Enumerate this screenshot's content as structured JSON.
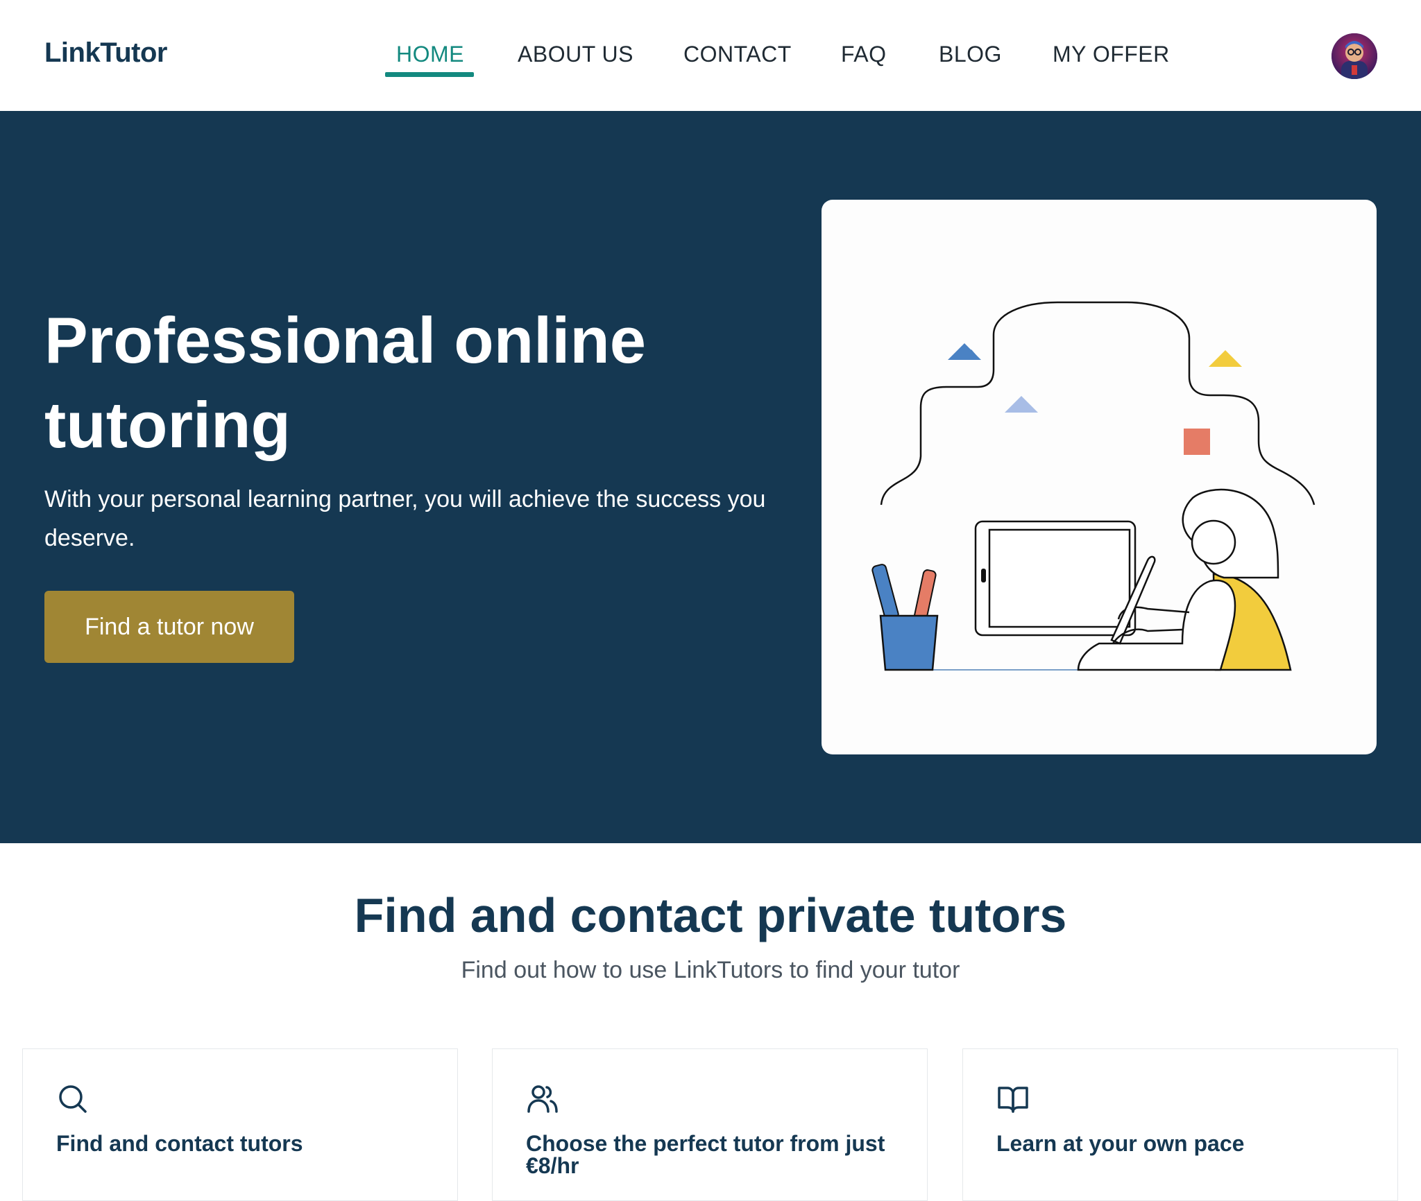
{
  "header": {
    "logo": "LinkTutor",
    "nav": [
      {
        "label": "HOME",
        "active": true
      },
      {
        "label": "ABOUT US",
        "active": false
      },
      {
        "label": "CONTACT",
        "active": false
      },
      {
        "label": "FAQ",
        "active": false
      },
      {
        "label": "BLOG",
        "active": false
      },
      {
        "label": "MY OFFER",
        "active": false
      }
    ],
    "avatar_icon": "user-avatar"
  },
  "hero": {
    "title": "Professional online tutoring",
    "subtitle": "With your personal learning partner, you will achieve the success you deserve.",
    "cta_label": "Find a tutor now",
    "illustration": "person-studying-at-tablet-illustration"
  },
  "section": {
    "title": "Find and contact private tutors",
    "subtitle": "Find out how to use LinkTutors to find your tutor"
  },
  "features": [
    {
      "icon": "search-icon",
      "title": "Find and contact tutors"
    },
    {
      "icon": "users-icon",
      "title": "Choose the perfect tutor from just €8/hr"
    },
    {
      "icon": "book-open-icon",
      "title": "Learn at your own pace"
    }
  ],
  "colors": {
    "brand_dark": "#153852",
    "accent_teal": "#13897f",
    "cta_gold": "#a08634"
  }
}
